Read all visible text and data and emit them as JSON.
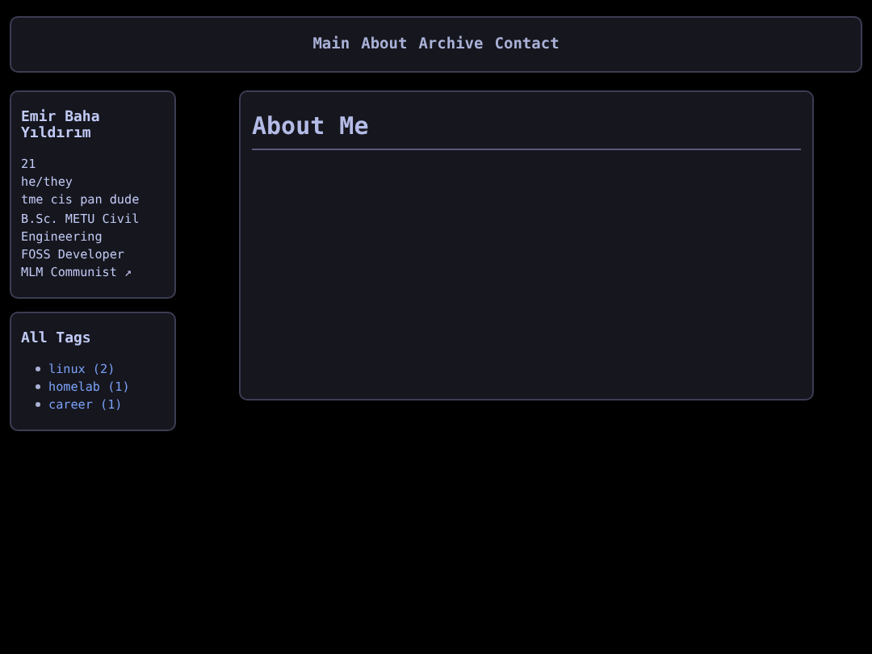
{
  "nav": {
    "links": [
      "Main",
      "About",
      "Archive",
      "Contact"
    ]
  },
  "profile": {
    "name": "Emir Baha Yıldırım",
    "lines": [
      "21",
      "he/they",
      "tme cis pan dude",
      "B.Sc. METU Civil Engineering",
      "FOSS Developer",
      "MLM Communist ↗"
    ]
  },
  "tags": {
    "title": "All Tags",
    "items": [
      "linux (2)",
      "homelab (1)",
      "career (1)"
    ]
  },
  "main": {
    "title": "About Me"
  }
}
